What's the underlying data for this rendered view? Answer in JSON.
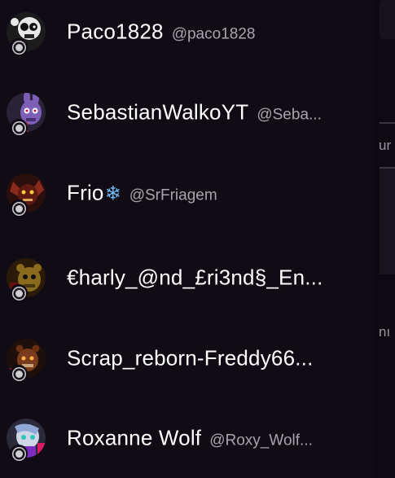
{
  "users": [
    {
      "name": "Paco1828",
      "handle": "@paco1828",
      "avatar": "black-white-animatronic-avatar"
    },
    {
      "name": "SebastianWalkoYT",
      "handle": "@Seba...",
      "avatar": "purple-bonnie-avatar"
    },
    {
      "name": "Frio",
      "name_suffix_icon": "snowflake-icon",
      "name_suffix": "❄",
      "handle": "@SrFriagem",
      "avatar": "dark-red-animatronic-avatar"
    },
    {
      "name": "€harly_@nd_£ri3nd§_En...",
      "handle": "",
      "avatar": "golden-freddy-avatar"
    },
    {
      "name": "Scrap_reborn-Freddy66...",
      "handle": "",
      "avatar": "scrap-freddy-avatar"
    },
    {
      "name": "Roxanne Wolf",
      "handle": "@Roxy_Wolf...",
      "avatar": "roxanne-wolf-avatar"
    }
  ],
  "side_panel": {
    "text_1": "ur",
    "text_2": "nı"
  },
  "colors": {
    "background": "#110b16",
    "name_text": "#ffffff",
    "handle_text": "#a8a4ac",
    "snowflake": "#6fb7ee"
  }
}
